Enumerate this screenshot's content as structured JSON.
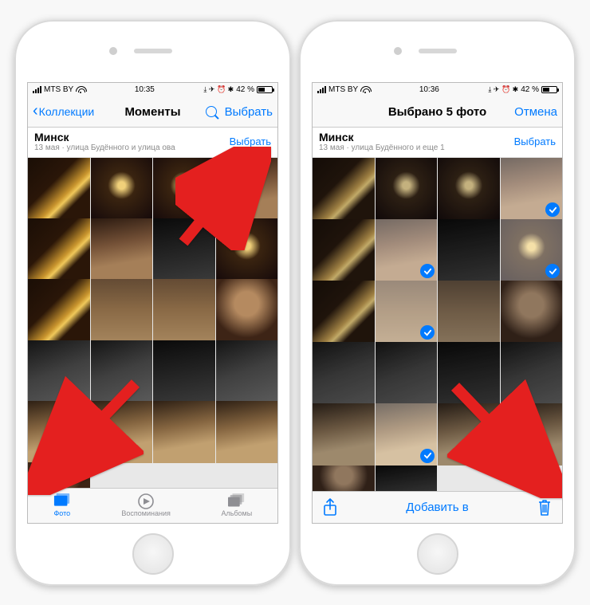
{
  "left": {
    "status": {
      "carrier": "MTS BY",
      "time": "10:35",
      "battery": "42 %",
      "icons": "⤓ ✈︎ ⏰ ✱"
    },
    "nav": {
      "back": "Коллекции",
      "title": "Моменты",
      "select": "Выбрать"
    },
    "section": {
      "location": "Минск",
      "subtitle": "13 мая · улица Будённого и улица ова",
      "select": "Выбрать"
    },
    "tabs": {
      "photos": "Фото",
      "memories": "Воспоминания",
      "albums": "Альбомы"
    }
  },
  "right": {
    "status": {
      "carrier": "MTS BY",
      "time": "10:36",
      "battery": "42 %",
      "icons": "⤓ ✈︎ ⏰ ✱"
    },
    "nav": {
      "title": "Выбрано 5 фото",
      "cancel": "Отмена"
    },
    "section": {
      "location": "Минск",
      "subtitle": "13 мая · улица Будённого и еще 1",
      "select": "Выбрать"
    },
    "toolbar": {
      "addto": "Добавить в"
    }
  },
  "colors": {
    "accent": "#007aff"
  }
}
